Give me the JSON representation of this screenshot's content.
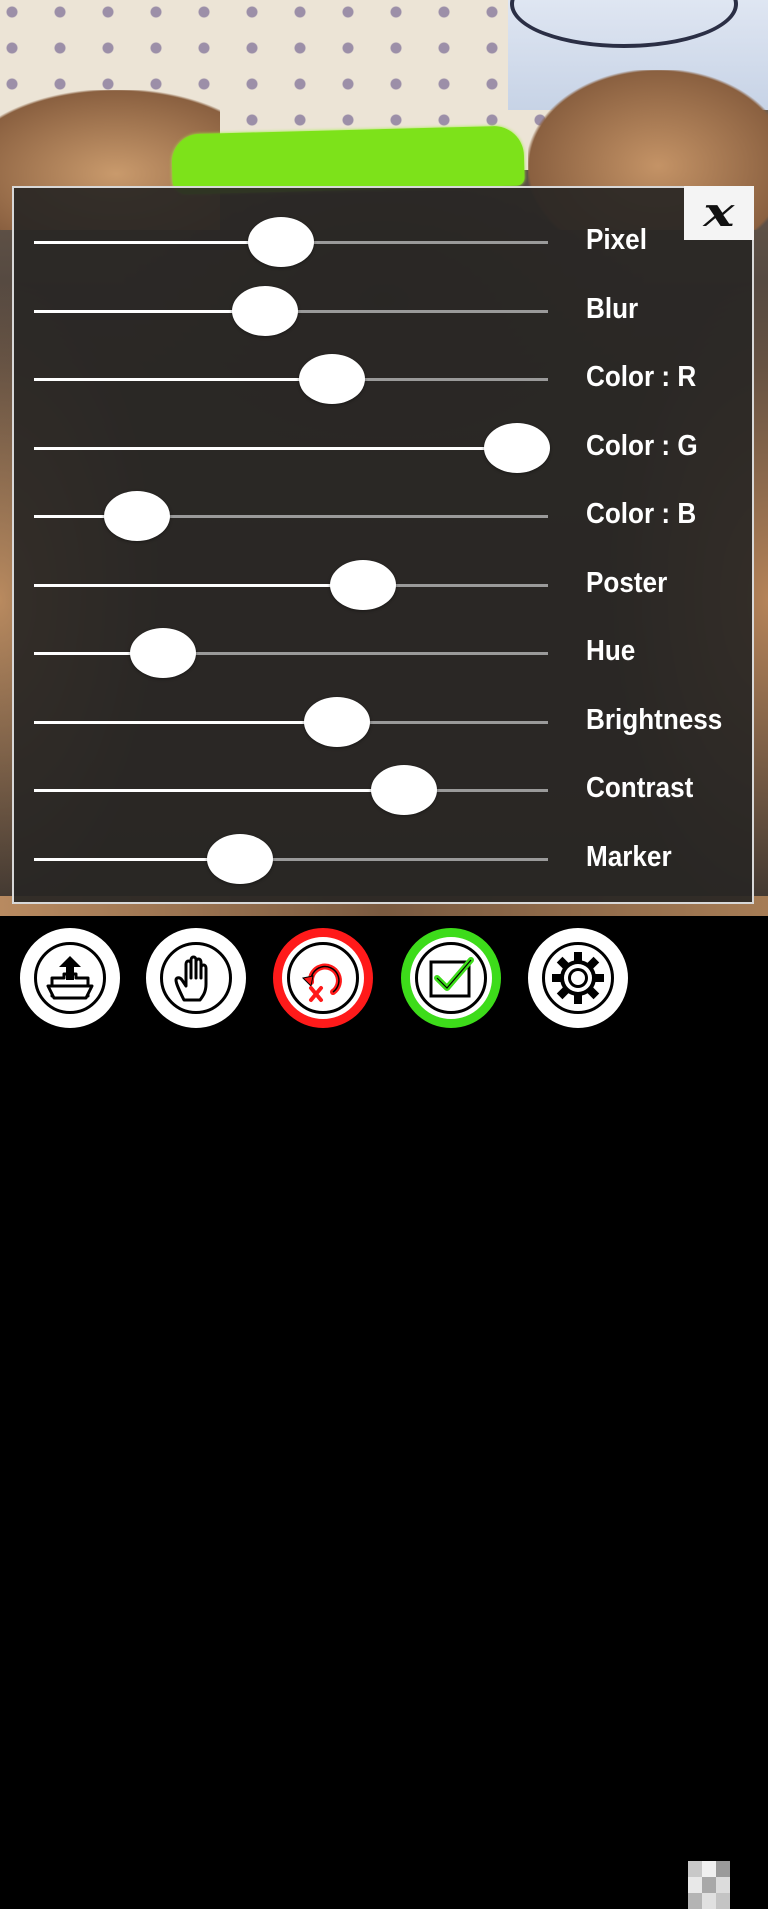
{
  "panel": {
    "close_icon": "close-icon",
    "sliders": [
      {
        "label": "Pixel",
        "value": 0.48
      },
      {
        "label": "Blur",
        "value": 0.45
      },
      {
        "label": "Color : R",
        "value": 0.58
      },
      {
        "label": "Color : G",
        "value": 0.94
      },
      {
        "label": "Color : B",
        "value": 0.2
      },
      {
        "label": "Poster",
        "value": 0.64
      },
      {
        "label": "Hue",
        "value": 0.25
      },
      {
        "label": "Brightness",
        "value": 0.59
      },
      {
        "label": "Contrast",
        "value": 0.72
      },
      {
        "label": "Marker",
        "value": 0.4
      }
    ]
  },
  "toolbar": {
    "buttons": [
      {
        "icon": "export-icon",
        "ring_color": "#ffffff"
      },
      {
        "icon": "hand-icon",
        "ring_color": "#ffffff"
      },
      {
        "icon": "undo-icon",
        "ring_color": "#ff1a1a"
      },
      {
        "icon": "checkmark-icon",
        "ring_color": "#3ddc1a"
      },
      {
        "icon": "gear-icon",
        "ring_color": "#ffffff"
      },
      {
        "icon": "mosaic-icon",
        "ring_color": "none"
      }
    ]
  },
  "colors": {
    "panel_bg": "#282624",
    "marker_green": "#7de21a",
    "accent_red": "#ff1a1a",
    "accent_green": "#3ddc1a"
  }
}
